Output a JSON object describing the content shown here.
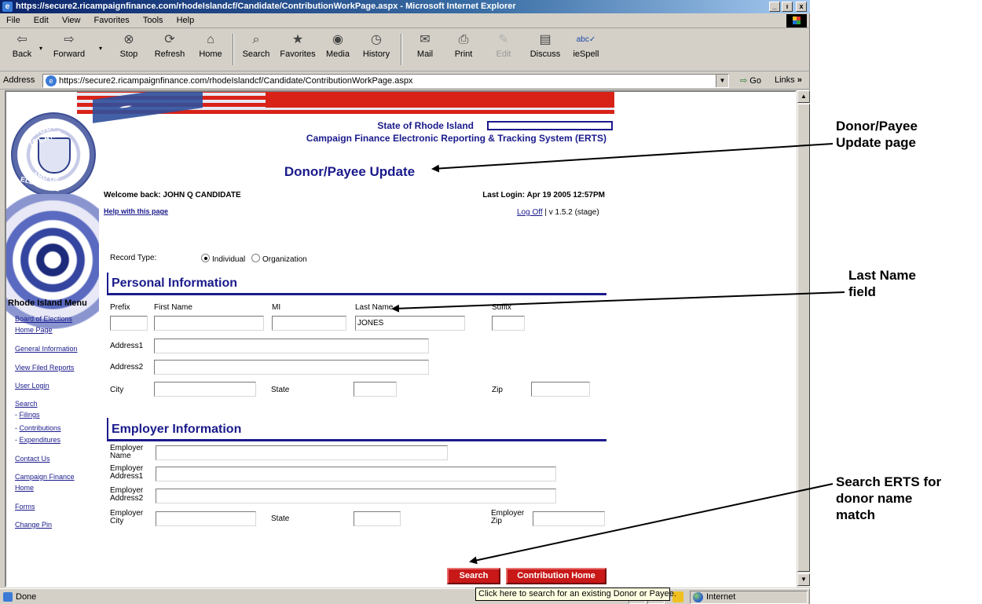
{
  "window": {
    "title": "https://secure2.ricampaignfinance.com/rhodeIslandcf/Candidate/ContributionWorkPage.aspx - Microsoft Internet Explorer",
    "minimize": "_",
    "maximize": "ı",
    "close": "x"
  },
  "menu": [
    "File",
    "Edit",
    "View",
    "Favorites",
    "Tools",
    "Help"
  ],
  "toolbar": {
    "back": "Back",
    "forward": "Forward",
    "stop": "Stop",
    "refresh": "Refresh",
    "home": "Home",
    "search": "Search",
    "favorites": "Favorites",
    "media": "Media",
    "history": "History",
    "mail": "Mail",
    "print": "Print",
    "edit": "Edit",
    "discuss": "Discuss",
    "iespell": "ieSpell"
  },
  "address": {
    "label": "Address",
    "url": "https://secure2.ricampaignfinance.com/rhodeIslandcf/Candidate/ContributionWorkPage.aspx",
    "go": "Go",
    "links": "Links"
  },
  "page": {
    "seal_top": "RHODE ISLAND",
    "seal_bottom": "BOARD OF ELECTIONS",
    "state_title": "State of Rhode Island",
    "erts_title": "Campaign Finance Electronic Reporting & Tracking System (ERTS)",
    "title": "Donor/Payee Update",
    "welcome": "Welcome back: JOHN Q CANDIDATE",
    "last_login": "Last Login: Apr 19 2005 12:57PM",
    "help": "Help with this page",
    "logoff": "Log Off",
    "version": " | v 1.5.2 (stage)",
    "record_type_label": "Record Type:",
    "record_types": [
      "Individual",
      "Organization"
    ],
    "personal_section": "Personal Information",
    "employer_section": "Employer Information",
    "labels": {
      "prefix": "Prefix",
      "first_name": "First Name",
      "mi": "MI",
      "last_name": "Last Name",
      "suffix": "Suffix",
      "address1": "Address1",
      "address2": "Address2",
      "city": "City",
      "state": "State",
      "zip": "Zip",
      "employer_name_1": "Employer",
      "employer_name_2": "Name",
      "employer_addr1_1": "Employer",
      "employer_addr1_2": "Address1",
      "employer_addr2_1": "Employer",
      "employer_addr2_2": "Address2",
      "employer_city_1": "Employer",
      "employer_city_2": "City",
      "employer_state": "State",
      "employer_zip_1": "Employer",
      "employer_zip_2": "Zip"
    },
    "values": {
      "last_name": "JONES"
    },
    "buttons": {
      "search": "Search",
      "contribution_home": "Contribution Home"
    }
  },
  "nav": {
    "title": "Rhode Island Menu",
    "board_1": "Board of Elections",
    "board_2": "Home Page",
    "general": "General Information",
    "view_filed": "View Filed Reports",
    "user_login": "User Login",
    "search": "Search",
    "filings": "Filings",
    "contributions": "Contributions",
    "expenditures": "Expenditures",
    "contact": "Contact Us",
    "cf_1": "Campaign Finance",
    "cf_2": "Home",
    "forms": "Forms",
    "change_pin": "Change Pin"
  },
  "status": {
    "text": "Done",
    "zone": "Internet"
  },
  "tooltip": "Click here to search for an existing Donor or Payee.",
  "annotations": {
    "a1_1": "Donor/Payee",
    "a1_2": "Update page",
    "a2_1": "Last Name",
    "a2_2": "field",
    "a3_1": "Search ERTS for",
    "a3_2": "donor name",
    "a3_3": "match"
  }
}
